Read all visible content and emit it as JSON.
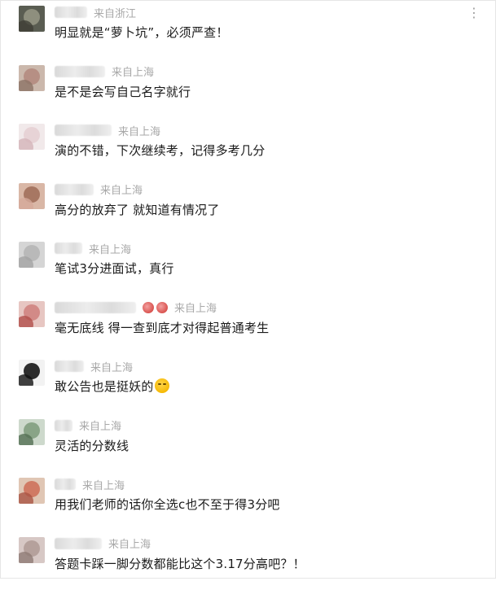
{
  "menu_icon": "more-dots-icon",
  "comments": [
    {
      "location": "来自浙江",
      "text": "明显就是“萝卜坑”，必须严查！",
      "name_blur_width": 40,
      "avatar": {
        "bg": "#5a5d52",
        "a": "#8e8f7e",
        "b": "#3e3f36"
      }
    },
    {
      "location": "来自上海",
      "text": "是不是会写自己名字就行",
      "name_blur_width": 62,
      "avatar": {
        "bg": "#cbb8ac",
        "a": "#b68f84",
        "b": "#8c7366"
      }
    },
    {
      "location": "来自上海",
      "text": "演的不错，下次继续考，记得多考几分",
      "name_blur_width": 70,
      "name_ext": "",
      "avatar": {
        "bg": "#f1e9ea",
        "a": "#e7d3d6",
        "b": "#d4b4b9"
      }
    },
    {
      "location": "来自上海",
      "text": "高分的放弃了 就知道有情况了",
      "name_blur_width": 48,
      "avatar": {
        "bg": "#d9b7a6",
        "a": "#a77763",
        "b": "#d5a99a"
      }
    },
    {
      "location": "来自上海",
      "text": "笔试3分进面试，真行",
      "name_blur_width": 34,
      "avatar": {
        "bg": "#d5d5d5",
        "a": "#b9b9b9",
        "b": "#a2a2a2"
      }
    },
    {
      "location": "来自上海",
      "text": "毫无底线 得一查到底才对得起普通考生",
      "name_blur_width": 100,
      "has_badges": true,
      "avatar": {
        "bg": "#e7c6c2",
        "a": "#d28a87",
        "b": "#b24e4a"
      }
    },
    {
      "location": "来自上海",
      "text": "敢公告也是挺妖的",
      "name_blur_width": 36,
      "name_ext": "",
      "has_emoji": true,
      "avatar": {
        "bg": "#f2f2f2",
        "a": "#2c2c2c",
        "b": "#111111"
      }
    },
    {
      "location": "来自上海",
      "text": "灵活的分数线",
      "name_blur_width": 22,
      "avatar": {
        "bg": "#cdd9cc",
        "a": "#89a487",
        "b": "#536e52"
      }
    },
    {
      "location": "来自上海",
      "text": "用我们老师的话你全选c也不至于得3分吧",
      "name_blur_width": 26,
      "avatar": {
        "bg": "#e0c6b4",
        "a": "#d07a64",
        "b": "#a95443"
      }
    },
    {
      "location": "来自上海",
      "text": "答题卡踩一脚分数都能比这个3.17分高吧？！",
      "name_blur_width": 58,
      "name_ext": "",
      "avatar": {
        "bg": "#d7c8c5",
        "a": "#b5a19c",
        "b": "#8e7b74"
      }
    }
  ]
}
